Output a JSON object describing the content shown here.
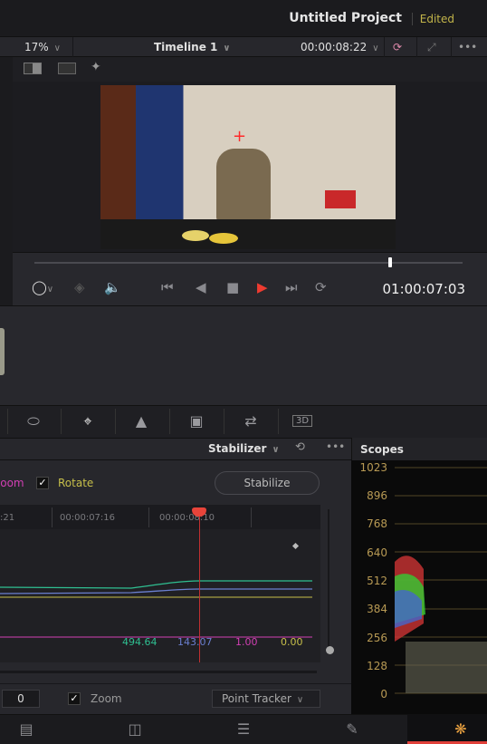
{
  "header": {
    "project": "Untitled Project",
    "status": "Edited"
  },
  "viewer": {
    "zoom": "17%",
    "timeline": "Timeline 1",
    "timecode": "00:00:08:22",
    "more": "•••"
  },
  "transport": {
    "timecode": "01:00:07:03",
    "scrub_position_pct": 83
  },
  "palette": {
    "icons": [
      "window-icon",
      "tracker-icon",
      "blur-icon",
      "key-icon",
      "sizing-icon",
      "3d-icon"
    ]
  },
  "stabilizer": {
    "mode": "Stabilizer",
    "more": "•••",
    "zoom_label": "Zoom",
    "rotate_label": "Rotate",
    "rotate_checked": true,
    "stabilize_button": "Stabilize",
    "ruler": [
      ":21",
      "00:00:07:16",
      "00:00:08:10"
    ],
    "values": {
      "pan": "494.64",
      "tilt": "143.07",
      "zoom": "1.00",
      "rotate": "0.00"
    },
    "field_value": "0",
    "zoom_checkbox_label": "Zoom",
    "zoom_checked": true,
    "tracker_mode": "Point Tracker"
  },
  "scopes": {
    "title": "Scopes",
    "scale": [
      "1023",
      "896",
      "768",
      "640",
      "512",
      "384",
      "256",
      "128",
      "0"
    ]
  },
  "colors": {
    "accent": "#e0403a",
    "pan": "#2fbf91",
    "tilt": "#6a7fd0",
    "zoom": "#d23fb4",
    "rotate": "#c7bf4a"
  }
}
